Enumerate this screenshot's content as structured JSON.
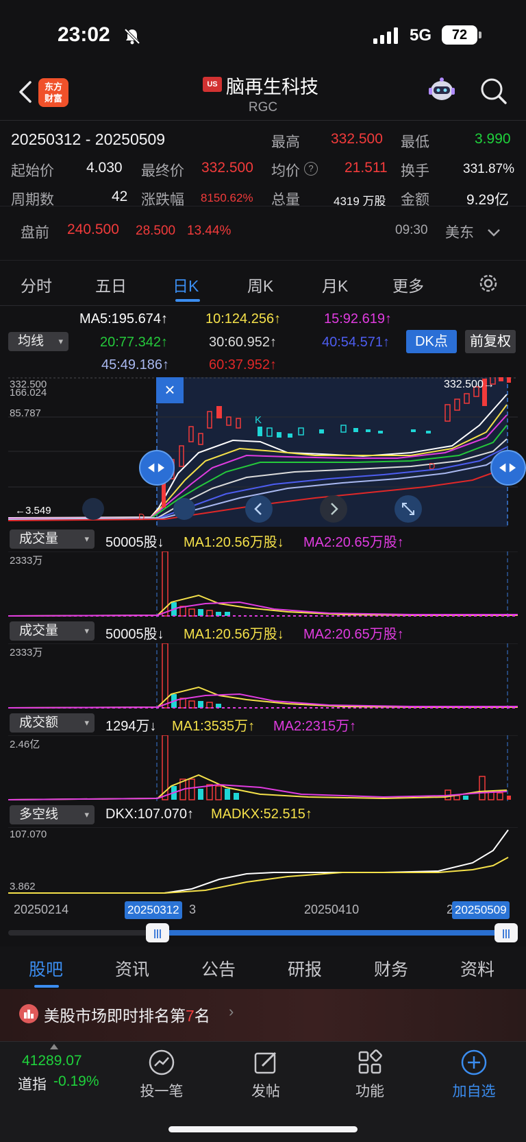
{
  "status_bar": {
    "time": "23:02",
    "network": "5G",
    "battery": "72"
  },
  "header": {
    "logo_line1": "东方",
    "logo_line2": "财富",
    "market_badge": "US",
    "stock_name": "脑再生科技",
    "stock_code": "RGC"
  },
  "period_stats": {
    "range": "20250312 - 20250509",
    "high_label": "最高",
    "high": "332.500",
    "low_label": "最低",
    "low": "3.990",
    "open_label": "起始价",
    "open": "4.030",
    "close_label": "最终价",
    "close": "332.500",
    "avg_label": "均价",
    "avg": "21.511",
    "turnover_label": "换手",
    "turnover": "331.87%",
    "periods_label": "周期数",
    "periods": "42",
    "change_label": "涨跌幅",
    "change": "8150.62%",
    "volume_label": "总量",
    "volume": "4319 万股",
    "amount_label": "金额",
    "amount": "9.29亿"
  },
  "premarket": {
    "label": "盘前",
    "price": "240.500",
    "change": "28.500",
    "change_pct": "13.44%",
    "time": "09:30",
    "zone": "美东"
  },
  "period_tabs": [
    "分时",
    "五日",
    "日K",
    "周K",
    "月K",
    "更多"
  ],
  "ma_legend": {
    "selector": "均线",
    "ma5": "MA5:195.674↑",
    "ma10": "10:124.256↑",
    "ma15": "15:92.619↑",
    "ma20": "20:77.342↑",
    "ma30": "30:60.952↑",
    "ma40": "40:54.571↑",
    "ma45": "45:49.186↑",
    "ma60": "60:37.952↑",
    "dk_button": "DK点",
    "adjust_button": "前复权"
  },
  "price_chart": {
    "labels": [
      "332.500",
      "166.024",
      "85.787"
    ],
    "last_marker": "332.500→",
    "low_marker": "←3.549",
    "k_marker": "K",
    "k_marker_2": "K",
    "d_marker": "D",
    "d_marker_2": "D"
  },
  "volume_panel_1": {
    "selector": "成交量",
    "value": "50005股↓",
    "ma1": "MA1:20.56万股↓",
    "ma2": "MA2:20.65万股↑",
    "max_label": "2333万"
  },
  "volume_panel_2": {
    "selector": "成交量",
    "value": "50005股↓",
    "ma1": "MA1:20.56万股↓",
    "ma2": "MA2:20.65万股↑",
    "max_label": "2333万"
  },
  "amount_panel": {
    "selector": "成交额",
    "value": "1294万↓",
    "ma1": "MA1:3535万↑",
    "ma2": "MA2:2315万↑",
    "max_label": "2.46亿"
  },
  "dkx_panel": {
    "selector": "多空线",
    "dkx": "DKX:107.070↑",
    "madkx": "MADKX:52.515↑",
    "max_label": "107.070",
    "min_label": "3.862"
  },
  "timeline": {
    "d1": "20250214",
    "chip_start": "20250312",
    "d2_tail": "3",
    "d3": "20250410",
    "d4_head": "2",
    "chip_end": "20250509"
  },
  "content_tabs": [
    "股吧",
    "资讯",
    "公告",
    "研报",
    "财务",
    "资料"
  ],
  "rank_banner": {
    "prefix": "美股市场即时排名第",
    "rank": "7",
    "suffix": "名"
  },
  "bottom_nav": {
    "index_value": "41289.07",
    "index_name": "道指",
    "index_change": "-0.19%",
    "items": [
      "投一笔",
      "发帖",
      "功能",
      "加自选"
    ]
  },
  "colors": {
    "accent": "#3b8df0",
    "up": "#f23b3b",
    "down": "#1fd23c",
    "ma5": "#ffffff",
    "ma10": "#f5e14a",
    "ma15": "#e03ce0",
    "ma20": "#25c93b",
    "ma30": "#dcdcdc",
    "ma40": "#4d5df0",
    "ma45": "#a9b8f0",
    "ma60": "#e02828"
  }
}
